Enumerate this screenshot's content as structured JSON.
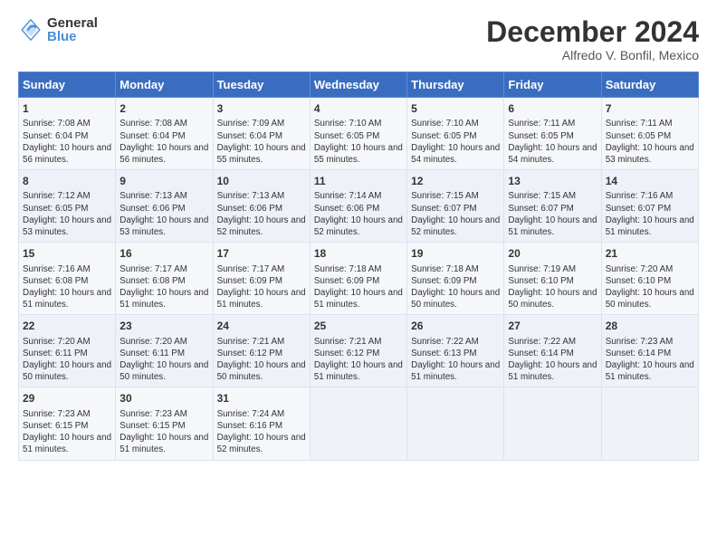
{
  "header": {
    "logo_general": "General",
    "logo_blue": "Blue",
    "month_title": "December 2024",
    "subtitle": "Alfredo V. Bonfil, Mexico"
  },
  "days_of_week": [
    "Sunday",
    "Monday",
    "Tuesday",
    "Wednesday",
    "Thursday",
    "Friday",
    "Saturday"
  ],
  "weeks": [
    [
      {
        "day": "1",
        "sunrise": "Sunrise: 7:08 AM",
        "sunset": "Sunset: 6:04 PM",
        "daylight": "Daylight: 10 hours and 56 minutes."
      },
      {
        "day": "2",
        "sunrise": "Sunrise: 7:08 AM",
        "sunset": "Sunset: 6:04 PM",
        "daylight": "Daylight: 10 hours and 56 minutes."
      },
      {
        "day": "3",
        "sunrise": "Sunrise: 7:09 AM",
        "sunset": "Sunset: 6:04 PM",
        "daylight": "Daylight: 10 hours and 55 minutes."
      },
      {
        "day": "4",
        "sunrise": "Sunrise: 7:10 AM",
        "sunset": "Sunset: 6:05 PM",
        "daylight": "Daylight: 10 hours and 55 minutes."
      },
      {
        "day": "5",
        "sunrise": "Sunrise: 7:10 AM",
        "sunset": "Sunset: 6:05 PM",
        "daylight": "Daylight: 10 hours and 54 minutes."
      },
      {
        "day": "6",
        "sunrise": "Sunrise: 7:11 AM",
        "sunset": "Sunset: 6:05 PM",
        "daylight": "Daylight: 10 hours and 54 minutes."
      },
      {
        "day": "7",
        "sunrise": "Sunrise: 7:11 AM",
        "sunset": "Sunset: 6:05 PM",
        "daylight": "Daylight: 10 hours and 53 minutes."
      }
    ],
    [
      {
        "day": "8",
        "sunrise": "Sunrise: 7:12 AM",
        "sunset": "Sunset: 6:05 PM",
        "daylight": "Daylight: 10 hours and 53 minutes."
      },
      {
        "day": "9",
        "sunrise": "Sunrise: 7:13 AM",
        "sunset": "Sunset: 6:06 PM",
        "daylight": "Daylight: 10 hours and 53 minutes."
      },
      {
        "day": "10",
        "sunrise": "Sunrise: 7:13 AM",
        "sunset": "Sunset: 6:06 PM",
        "daylight": "Daylight: 10 hours and 52 minutes."
      },
      {
        "day": "11",
        "sunrise": "Sunrise: 7:14 AM",
        "sunset": "Sunset: 6:06 PM",
        "daylight": "Daylight: 10 hours and 52 minutes."
      },
      {
        "day": "12",
        "sunrise": "Sunrise: 7:15 AM",
        "sunset": "Sunset: 6:07 PM",
        "daylight": "Daylight: 10 hours and 52 minutes."
      },
      {
        "day": "13",
        "sunrise": "Sunrise: 7:15 AM",
        "sunset": "Sunset: 6:07 PM",
        "daylight": "Daylight: 10 hours and 51 minutes."
      },
      {
        "day": "14",
        "sunrise": "Sunrise: 7:16 AM",
        "sunset": "Sunset: 6:07 PM",
        "daylight": "Daylight: 10 hours and 51 minutes."
      }
    ],
    [
      {
        "day": "15",
        "sunrise": "Sunrise: 7:16 AM",
        "sunset": "Sunset: 6:08 PM",
        "daylight": "Daylight: 10 hours and 51 minutes."
      },
      {
        "day": "16",
        "sunrise": "Sunrise: 7:17 AM",
        "sunset": "Sunset: 6:08 PM",
        "daylight": "Daylight: 10 hours and 51 minutes."
      },
      {
        "day": "17",
        "sunrise": "Sunrise: 7:17 AM",
        "sunset": "Sunset: 6:09 PM",
        "daylight": "Daylight: 10 hours and 51 minutes."
      },
      {
        "day": "18",
        "sunrise": "Sunrise: 7:18 AM",
        "sunset": "Sunset: 6:09 PM",
        "daylight": "Daylight: 10 hours and 51 minutes."
      },
      {
        "day": "19",
        "sunrise": "Sunrise: 7:18 AM",
        "sunset": "Sunset: 6:09 PM",
        "daylight": "Daylight: 10 hours and 50 minutes."
      },
      {
        "day": "20",
        "sunrise": "Sunrise: 7:19 AM",
        "sunset": "Sunset: 6:10 PM",
        "daylight": "Daylight: 10 hours and 50 minutes."
      },
      {
        "day": "21",
        "sunrise": "Sunrise: 7:20 AM",
        "sunset": "Sunset: 6:10 PM",
        "daylight": "Daylight: 10 hours and 50 minutes."
      }
    ],
    [
      {
        "day": "22",
        "sunrise": "Sunrise: 7:20 AM",
        "sunset": "Sunset: 6:11 PM",
        "daylight": "Daylight: 10 hours and 50 minutes."
      },
      {
        "day": "23",
        "sunrise": "Sunrise: 7:20 AM",
        "sunset": "Sunset: 6:11 PM",
        "daylight": "Daylight: 10 hours and 50 minutes."
      },
      {
        "day": "24",
        "sunrise": "Sunrise: 7:21 AM",
        "sunset": "Sunset: 6:12 PM",
        "daylight": "Daylight: 10 hours and 50 minutes."
      },
      {
        "day": "25",
        "sunrise": "Sunrise: 7:21 AM",
        "sunset": "Sunset: 6:12 PM",
        "daylight": "Daylight: 10 hours and 51 minutes."
      },
      {
        "day": "26",
        "sunrise": "Sunrise: 7:22 AM",
        "sunset": "Sunset: 6:13 PM",
        "daylight": "Daylight: 10 hours and 51 minutes."
      },
      {
        "day": "27",
        "sunrise": "Sunrise: 7:22 AM",
        "sunset": "Sunset: 6:14 PM",
        "daylight": "Daylight: 10 hours and 51 minutes."
      },
      {
        "day": "28",
        "sunrise": "Sunrise: 7:23 AM",
        "sunset": "Sunset: 6:14 PM",
        "daylight": "Daylight: 10 hours and 51 minutes."
      }
    ],
    [
      {
        "day": "29",
        "sunrise": "Sunrise: 7:23 AM",
        "sunset": "Sunset: 6:15 PM",
        "daylight": "Daylight: 10 hours and 51 minutes."
      },
      {
        "day": "30",
        "sunrise": "Sunrise: 7:23 AM",
        "sunset": "Sunset: 6:15 PM",
        "daylight": "Daylight: 10 hours and 51 minutes."
      },
      {
        "day": "31",
        "sunrise": "Sunrise: 7:24 AM",
        "sunset": "Sunset: 6:16 PM",
        "daylight": "Daylight: 10 hours and 52 minutes."
      },
      null,
      null,
      null,
      null
    ]
  ]
}
